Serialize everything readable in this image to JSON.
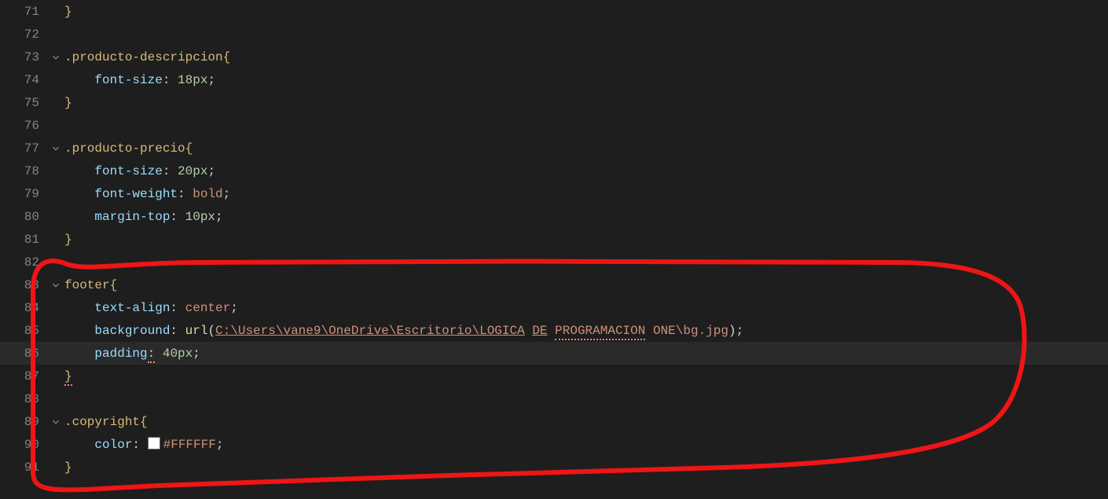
{
  "lines": [
    {
      "num": "71",
      "fold": "",
      "indent": "",
      "parts": [
        {
          "t": "brace",
          "v": "}"
        }
      ]
    },
    {
      "num": "72",
      "fold": "",
      "indent": "",
      "parts": []
    },
    {
      "num": "73",
      "fold": "down",
      "indent": "",
      "parts": [
        {
          "t": "selector",
          "v": ".producto-descripcion"
        },
        {
          "t": "brace",
          "v": "{"
        }
      ]
    },
    {
      "num": "74",
      "fold": "",
      "indent": "    ",
      "parts": [
        {
          "t": "prop",
          "v": "font-size"
        },
        {
          "t": "colon",
          "v": ": "
        },
        {
          "t": "num",
          "v": "18px"
        },
        {
          "t": "semi",
          "v": ";"
        }
      ]
    },
    {
      "num": "75",
      "fold": "",
      "indent": "",
      "parts": [
        {
          "t": "brace",
          "v": "}"
        }
      ]
    },
    {
      "num": "76",
      "fold": "",
      "indent": "",
      "parts": []
    },
    {
      "num": "77",
      "fold": "down",
      "indent": "",
      "parts": [
        {
          "t": "selector",
          "v": ".producto-precio"
        },
        {
          "t": "brace",
          "v": "{"
        }
      ]
    },
    {
      "num": "78",
      "fold": "",
      "indent": "    ",
      "parts": [
        {
          "t": "prop",
          "v": "font-size"
        },
        {
          "t": "colon",
          "v": ": "
        },
        {
          "t": "num",
          "v": "20px"
        },
        {
          "t": "semi",
          "v": ";"
        }
      ]
    },
    {
      "num": "79",
      "fold": "",
      "indent": "    ",
      "parts": [
        {
          "t": "prop",
          "v": "font-weight"
        },
        {
          "t": "colon",
          "v": ": "
        },
        {
          "t": "val",
          "v": "bold"
        },
        {
          "t": "semi",
          "v": ";"
        }
      ]
    },
    {
      "num": "80",
      "fold": "",
      "indent": "    ",
      "parts": [
        {
          "t": "prop",
          "v": "margin-top"
        },
        {
          "t": "colon",
          "v": ": "
        },
        {
          "t": "num",
          "v": "10px"
        },
        {
          "t": "semi",
          "v": ";"
        }
      ]
    },
    {
      "num": "81",
      "fold": "",
      "indent": "",
      "parts": [
        {
          "t": "brace",
          "v": "}"
        }
      ]
    },
    {
      "num": "82",
      "fold": "",
      "indent": "",
      "parts": []
    },
    {
      "num": "83",
      "fold": "down",
      "indent": "",
      "parts": [
        {
          "t": "selector",
          "v": "footer"
        },
        {
          "t": "brace",
          "v": "{"
        }
      ]
    },
    {
      "num": "84",
      "fold": "",
      "indent": "    ",
      "parts": [
        {
          "t": "prop",
          "v": "text-align"
        },
        {
          "t": "colon",
          "v": ": "
        },
        {
          "t": "val",
          "v": "center"
        },
        {
          "t": "semi",
          "v": ";"
        }
      ]
    },
    {
      "num": "85",
      "fold": "",
      "indent": "    ",
      "parts": [
        {
          "t": "prop",
          "v": "background"
        },
        {
          "t": "colon",
          "v": ": "
        },
        {
          "t": "func",
          "v": "url"
        },
        {
          "t": "paren",
          "v": "("
        },
        {
          "t": "url",
          "v": "C:\\Users\\vane9\\OneDrive\\Escritorio\\LOGICA"
        },
        {
          "t": "space",
          "v": " "
        },
        {
          "t": "url",
          "v": "DE"
        },
        {
          "t": "space",
          "v": " "
        },
        {
          "t": "url-nolink",
          "v": "PROGRAMACION",
          "sq": true
        },
        {
          "t": "space",
          "v": " "
        },
        {
          "t": "url-nolink",
          "v": "ONE\\bg.jpg"
        },
        {
          "t": "paren",
          "v": ")"
        },
        {
          "t": "semi",
          "v": ";"
        }
      ]
    },
    {
      "num": "86",
      "fold": "",
      "indent": "    ",
      "parts": [
        {
          "t": "prop",
          "v": "padding"
        },
        {
          "t": "colon",
          "v": ":",
          "sq": true
        },
        {
          "t": "colon",
          "v": " "
        },
        {
          "t": "num",
          "v": "40px"
        },
        {
          "t": "semi",
          "v": ";"
        }
      ],
      "current": true
    },
    {
      "num": "87",
      "fold": "",
      "indent": "",
      "parts": [
        {
          "t": "brace",
          "v": "}",
          "sq": true
        }
      ]
    },
    {
      "num": "88",
      "fold": "",
      "indent": "",
      "parts": []
    },
    {
      "num": "89",
      "fold": "down",
      "indent": "",
      "parts": [
        {
          "t": "selector",
          "v": ".copyright"
        },
        {
          "t": "brace",
          "v": "{"
        }
      ]
    },
    {
      "num": "90",
      "fold": "",
      "indent": "    ",
      "parts": [
        {
          "t": "prop",
          "v": "color"
        },
        {
          "t": "colon",
          "v": ": "
        },
        {
          "t": "swatch",
          "v": ""
        },
        {
          "t": "val",
          "v": "#FFFFFF"
        },
        {
          "t": "semi",
          "v": ";"
        }
      ]
    },
    {
      "num": "91",
      "fold": "",
      "indent": "",
      "parts": [
        {
          "t": "brace",
          "v": "}"
        }
      ]
    }
  ],
  "annotation": {
    "stroke": "#ef1515",
    "strokeWidth": 6
  }
}
